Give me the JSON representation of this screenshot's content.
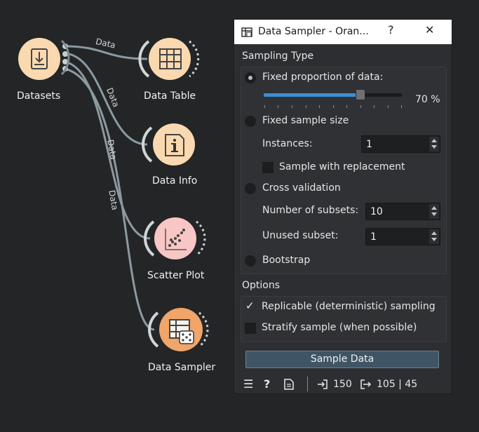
{
  "canvas": {
    "nodes": {
      "datasets": {
        "label": "Datasets",
        "icon": "download-file-icon"
      },
      "data_table": {
        "label": "Data Table",
        "icon": "table-grid-icon"
      },
      "data_info": {
        "label": "Data Info",
        "icon": "info-icon"
      },
      "scatter_plot": {
        "label": "Scatter Plot",
        "icon": "scatter-chart-icon"
      },
      "data_sampler": {
        "label": "Data Sampler",
        "icon": "dice-table-icon"
      }
    },
    "links": {
      "l1": "Data",
      "l2": "Data",
      "l3": "Data",
      "l4": "Data"
    }
  },
  "dialog": {
    "title": "Data Sampler - Oran...",
    "help_button": "?",
    "close_button": "✕",
    "sampling_type_title": "Sampling Type",
    "fixed_proportion_label": "Fixed proportion of data:",
    "proportion_value_text": "70 %",
    "proportion_value": 70,
    "fixed_size_label": "Fixed sample size",
    "instances_label": "Instances:",
    "instances_value": "1",
    "replacement_label": "Sample with replacement",
    "cross_validation_label": "Cross validation",
    "subsets_label": "Number of subsets:",
    "subsets_value": "10",
    "unused_subset_label": "Unused subset:",
    "unused_subset_value": "1",
    "bootstrap_label": "Bootstrap",
    "options_title": "Options",
    "replicable_label": "Replicable (deterministic) sampling",
    "replicable_checked": true,
    "stratify_label": "Stratify sample (when possible)",
    "stratify_checked": false,
    "sample_button": "Sample Data"
  },
  "status": {
    "input_count": "150",
    "output_count": "105 | 45"
  },
  "colors": {
    "node_orange": "#fbd9b0",
    "node_pink": "#f8c6c4",
    "link": "#8a9aa0",
    "slider_fill": "#3d8fd6"
  }
}
